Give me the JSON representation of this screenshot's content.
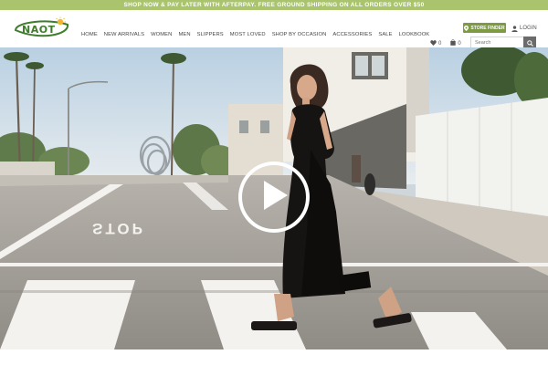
{
  "promo": {
    "text": "SHOP NOW & PAY LATER WITH AFTERPAY. FREE GROUND SHIPPING ON ALL ORDERS OVER $50"
  },
  "brand": {
    "logo_text": "NAOT",
    "colors": {
      "green": "#3e7d2a",
      "sun": "#f2b632",
      "promo_bg": "#a9c46c"
    }
  },
  "nav": {
    "items": [
      {
        "label": "HOME"
      },
      {
        "label": "NEW ARRIVALS"
      },
      {
        "label": "WOMEN"
      },
      {
        "label": "MEN"
      },
      {
        "label": "SLIPPERS"
      },
      {
        "label": "MOST LOVED"
      },
      {
        "label": "SHOP BY OCCASION"
      },
      {
        "label": "ACCESSORIES"
      },
      {
        "label": "SALE"
      },
      {
        "label": "LOOKBOOK"
      }
    ]
  },
  "utility": {
    "store_finder": "STORE FINDER",
    "login": "LOGIN",
    "wishlist_count": "0",
    "cart_count": "0",
    "search_placeholder": "Search"
  },
  "hero": {
    "road_text": "STOP",
    "icons": {
      "play": "play-icon",
      "search": "search-icon",
      "user": "user-icon",
      "heart": "heart-icon",
      "bag": "shopping-bag-icon",
      "pin": "map-pin-icon"
    }
  }
}
